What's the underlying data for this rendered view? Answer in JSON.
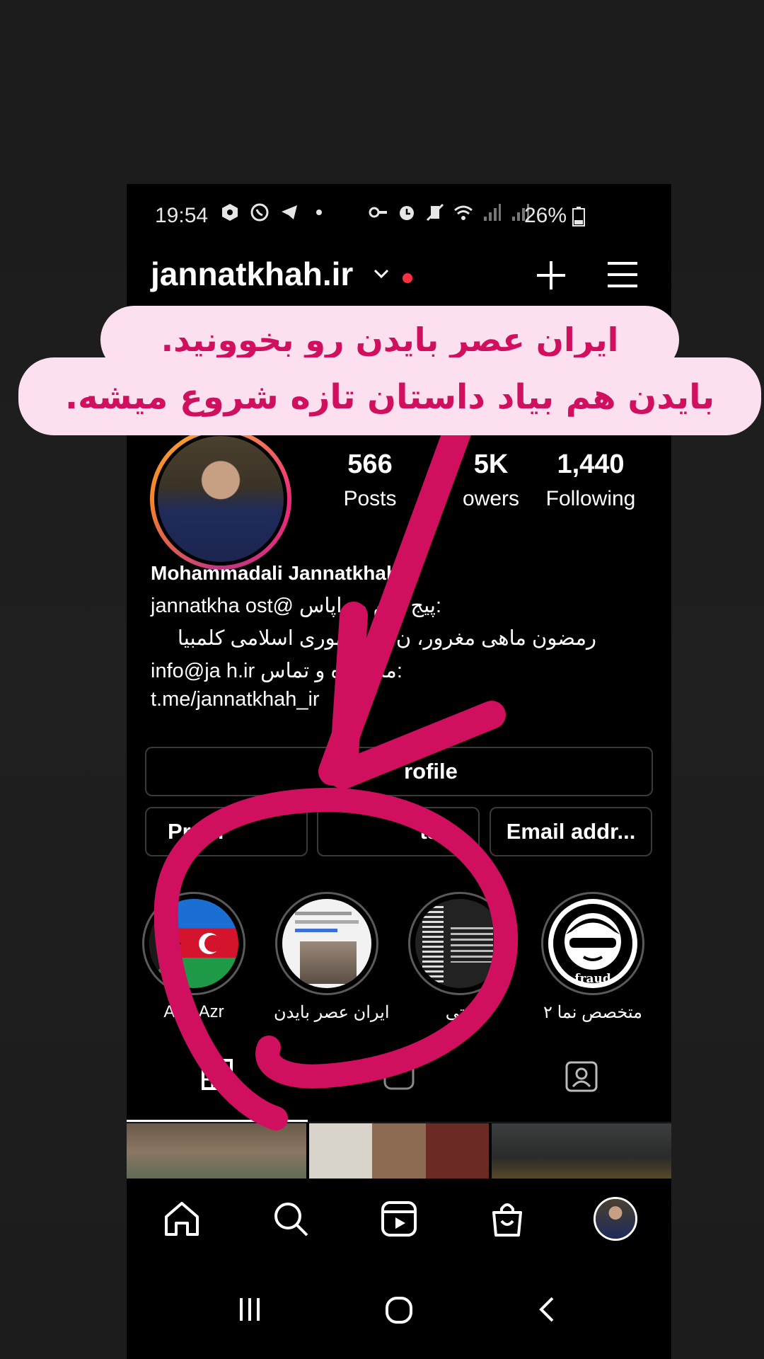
{
  "status_bar": {
    "time": "19:54",
    "battery": "26%",
    "icons_left": [
      "nodes-icon",
      "whatsapp-icon",
      "telegram-icon",
      "dot-icon"
    ],
    "icons_right": [
      "key-icon",
      "alarm-icon",
      "mute-icon",
      "wifi-icon",
      "signal-icon",
      "signal-icon"
    ]
  },
  "header": {
    "username": "jannatkhah.ir",
    "has_notification": true
  },
  "stats": {
    "posts_count": "566",
    "posts_label": "Posts",
    "followers_count": "5K",
    "followers_label": "owers",
    "following_count": "1,440",
    "following_label": "Following"
  },
  "bio": {
    "name": "Mohammadali Jannatkhah",
    "line1": ":پیج دوم و زاپاس @jannatkha      ost",
    "line2": "رمضون ماهی مغرور، ن             ل جمهوری اسلامی کلمبیا",
    "line3": ":مشاوره و تماس info@ja           h.ir",
    "link": "t.me/jannatkhah_ir"
  },
  "buttons": {
    "edit_profile": "rofile",
    "promotions": "Prom",
    "insights": "ts",
    "email": "Email addr..."
  },
  "highlights": [
    {
      "label": "Arm       Azr",
      "type": "flags"
    },
    {
      "label": "ایران عصر بایدن",
      "type": "news"
    },
    {
      "label": "نتی!",
      "type": "text"
    },
    {
      "label": "متخصص نما ۲",
      "type": "fraud",
      "badge": "fraud"
    }
  ],
  "caption": {
    "line1": "ایران عصر بایدن رو بخوونید.",
    "line2": "بایدن هم بیاد داستان تازه شروع میشه."
  },
  "colors": {
    "annotation_magenta": "#d0105e",
    "caption_bg": "#fde0ef",
    "notification_red": "#ff3040"
  }
}
